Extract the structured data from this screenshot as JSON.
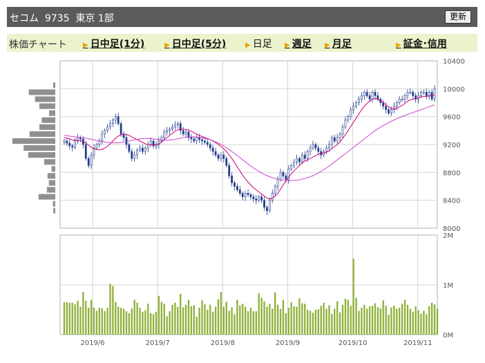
{
  "header": {
    "ticker": "セコム  9735  東京 1部",
    "update_button": "更新"
  },
  "nav": {
    "label": "株価チャート",
    "items": [
      {
        "label": "日中足(1分)",
        "link": true
      },
      {
        "label": "日中足(5分)",
        "link": true
      },
      {
        "label": "日足",
        "link": false
      },
      {
        "label": "週足",
        "link": true
      },
      {
        "label": "月足",
        "link": true
      },
      {
        "label": "証金･信用",
        "link": true
      }
    ]
  },
  "colors": {
    "up_candle": "#ffffff",
    "down_candle": "#1f3b8a",
    "ma_short": "#cc0077",
    "ma_long": "#cc44cc",
    "volume": "#8fb13a",
    "volume_profile": "#909090",
    "grid": "#d4d4d4",
    "frame": "#b0b0b0"
  },
  "chart_data": [
    {
      "type": "candlestick",
      "title": "",
      "ylim": [
        8000,
        10400
      ],
      "yticks": [
        "10400",
        "10000",
        "9600",
        "9200",
        "8800",
        "8400",
        "8000"
      ],
      "x_labels": [
        "2019/6",
        "2019/7",
        "2019/8",
        "2019/9",
        "2019/10",
        "2019/11"
      ],
      "close": [
        9250,
        9220,
        9180,
        9160,
        9250,
        9300,
        9280,
        9200,
        9000,
        8900,
        9050,
        9150,
        9200,
        9250,
        9350,
        9400,
        9450,
        9500,
        9550,
        9600,
        9500,
        9350,
        9300,
        9200,
        9100,
        9000,
        9050,
        9120,
        9150,
        9100,
        9150,
        9200,
        9250,
        9180,
        9200,
        9250,
        9300,
        9380,
        9400,
        9420,
        9450,
        9480,
        9500,
        9400,
        9350,
        9380,
        9300,
        9280,
        9250,
        9300,
        9270,
        9250,
        9230,
        9200,
        9150,
        9100,
        9050,
        9000,
        9050,
        9000,
        8900,
        8750,
        8650,
        8600,
        8550,
        8500,
        8450,
        8500,
        8480,
        8450,
        8420,
        8400,
        8450,
        8400,
        8300,
        8250,
        8400,
        8500,
        8600,
        8700,
        8800,
        8750,
        8700,
        8850,
        8900,
        8950,
        9000,
        8950,
        9050,
        9000,
        9100,
        9150,
        9200,
        9150,
        9100,
        9050,
        9100,
        9150,
        9200,
        9300,
        9250,
        9300,
        9350,
        9450,
        9550,
        9600,
        9700,
        9750,
        9800,
        9850,
        9900,
        9950,
        9900,
        9850,
        9950,
        9900,
        9850,
        9800,
        9750,
        9700,
        9650,
        9700,
        9750,
        9800,
        9850,
        9850,
        9900,
        9950,
        9950,
        9900,
        9850,
        9900,
        9950,
        9950,
        9900,
        9950,
        9850,
        10000
      ],
      "series": [
        {
          "name": "",
          "values": [
            9300,
            9290,
            9280,
            9265,
            9260,
            9260,
            9255,
            9245,
            9220,
            9190,
            9160,
            9140,
            9130,
            9125,
            9130,
            9150,
            9175,
            9210,
            9250,
            9290,
            9320,
            9340,
            9350,
            9345,
            9330,
            9310,
            9290,
            9270,
            9250,
            9230,
            9210,
            9200,
            9195,
            9190,
            9195,
            9210,
            9235,
            9265,
            9300,
            9330,
            9360,
            9390,
            9410,
            9420,
            9420,
            9415,
            9405,
            9390,
            9370,
            9350,
            9330,
            9315,
            9300,
            9285,
            9270,
            9250,
            9230,
            9200,
            9170,
            9140,
            9100,
            9050,
            9000,
            8940,
            8880,
            8820,
            8760,
            8710,
            8660,
            8620,
            8580,
            8550,
            8520,
            8490,
            8460,
            8430,
            8420,
            8430,
            8460,
            8500,
            8560,
            8620,
            8680,
            8730,
            8780,
            8820,
            8860,
            8900,
            8940,
            8960,
            8980,
            9000,
            9020,
            9040,
            9060,
            9070,
            9080,
            9090,
            9110,
            9140,
            9170,
            9200,
            9240,
            9290,
            9340,
            9400,
            9460,
            9520,
            9580,
            9640,
            9700,
            9750,
            9790,
            9820,
            9850,
            9860,
            9850,
            9830,
            9800,
            9770,
            9740,
            9720,
            9710,
            9720,
            9740,
            9760,
            9790,
            9820,
            9840,
            9850,
            9860,
            9870,
            9880,
            9890,
            9890,
            9895,
            9900,
            9910
          ]
        },
        {
          "name": "",
          "values": [
            9330,
            9325,
            9320,
            9315,
            9310,
            9305,
            9300,
            9295,
            9290,
            9282,
            9274,
            9266,
            9258,
            9250,
            9242,
            9236,
            9230,
            9226,
            9224,
            9224,
            9226,
            9230,
            9236,
            9244,
            9252,
            9260,
            9268,
            9274,
            9280,
            9284,
            9286,
            9286,
            9284,
            9280,
            9275,
            9270,
            9265,
            9262,
            9262,
            9264,
            9268,
            9274,
            9282,
            9290,
            9298,
            9304,
            9308,
            9310,
            9310,
            9308,
            9304,
            9298,
            9290,
            9280,
            9268,
            9254,
            9238,
            9220,
            9200,
            9178,
            9154,
            9128,
            9100,
            9070,
            9040,
            9010,
            8980,
            8950,
            8920,
            8892,
            8864,
            8838,
            8814,
            8792,
            8772,
            8754,
            8738,
            8724,
            8712,
            8702,
            8694,
            8688,
            8684,
            8682,
            8682,
            8684,
            8688,
            8694,
            8702,
            8712,
            8724,
            8738,
            8754,
            8772,
            8792,
            8814,
            8838,
            8864,
            8892,
            8920,
            8950,
            8980,
            9010,
            9040,
            9070,
            9100,
            9130,
            9160,
            9190,
            9220,
            9250,
            9280,
            9310,
            9340,
            9370,
            9400,
            9425,
            9450,
            9472,
            9494,
            9514,
            9534,
            9552,
            9570,
            9586,
            9602,
            9616,
            9630,
            9644,
            9658,
            9672,
            9686,
            9700,
            9714,
            9728,
            9742,
            9756,
            9770
          ]
        }
      ]
    },
    {
      "type": "bar",
      "title": "",
      "ylim": [
        0,
        2000000
      ],
      "yticks": [
        "2M",
        "1M",
        "0M"
      ],
      "values": [
        650000,
        650000,
        640000,
        640000,
        610000,
        680000,
        560000,
        860000,
        680000,
        540000,
        700000,
        540000,
        480000,
        540000,
        530000,
        470000,
        540000,
        1020000,
        980000,
        660000,
        560000,
        540000,
        520000,
        470000,
        430000,
        530000,
        700000,
        640000,
        540000,
        460000,
        490000,
        620000,
        430000,
        410000,
        460000,
        780000,
        660000,
        620000,
        370000,
        470000,
        600000,
        640000,
        560000,
        820000,
        550000,
        600000,
        700000,
        570000,
        590000,
        360000,
        540000,
        690000,
        610000,
        500000,
        600000,
        460000,
        560000,
        710000,
        860000,
        560000,
        660000,
        480000,
        550000,
        410000,
        700000,
        590000,
        620000,
        560000,
        470000,
        540000,
        470000,
        470000,
        830000,
        740000,
        670000,
        560000,
        620000,
        520000,
        850000,
        600000,
        520000,
        700000,
        430000,
        540000,
        650000,
        570000,
        560000,
        730000,
        630000,
        620000,
        500000,
        480000,
        440000,
        500000,
        510000,
        580000,
        640000,
        520000,
        590000,
        420000,
        520000,
        670000,
        450000,
        600000,
        720000,
        700000,
        580000,
        1530000,
        740000,
        480000,
        540000,
        600000,
        520000,
        570000,
        580000,
        630000,
        550000,
        530000,
        690000,
        580000,
        400000,
        550000,
        580000,
        520000,
        540000,
        620000,
        700000,
        600000,
        520000,
        460000,
        570000,
        490000,
        420000,
        480000,
        410000,
        570000,
        640000,
        610000,
        520000
      ]
    }
  ]
}
